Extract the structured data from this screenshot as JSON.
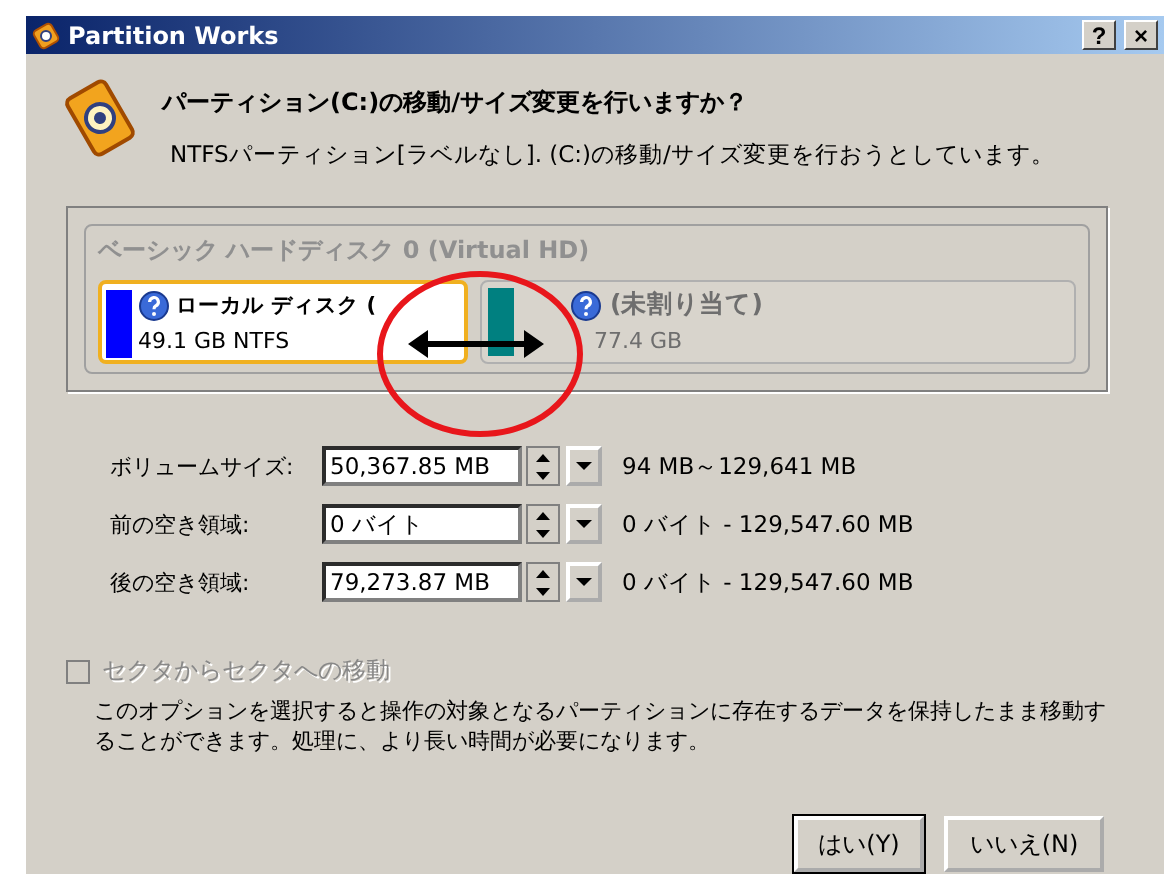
{
  "window": {
    "title": "Partition Works",
    "controls": [
      "?",
      "×"
    ]
  },
  "header": {
    "title": "パーティション(C:)の移動/サイズ変更を行いますか？",
    "subtitle": "NTFSパーティション[ラベルなし]. (C:)の移動/サイズ変更を行おうとしています。"
  },
  "disk": {
    "title": "ベーシック ハードディスク 0 (Virtual HD)",
    "partitions": [
      {
        "label": "ローカル ディスク (",
        "size": "49.1 GB NTFS",
        "color": "#0000ff",
        "selected": true
      },
      {
        "label": "(未割り当て)",
        "size": "77.4 GB",
        "color": "#008080",
        "selected": false
      }
    ]
  },
  "fields": [
    {
      "label": "ボリュームサイズ:",
      "value": "50,367.85 MB",
      "range": "94 MB～129,641 MB"
    },
    {
      "label": "前の空き領域:",
      "value": "0 バイト",
      "range": "0 バイト - 129,547.60 MB"
    },
    {
      "label": "後の空き領域:",
      "value": "79,273.87 MB",
      "range": "0 バイト - 129,547.60 MB"
    }
  ],
  "option": {
    "label": "セクタからセクタへの移動",
    "checked": false,
    "disabled": true,
    "description": "このオプションを選択すると操作の対象となるパーティションに存在するデータを保持したまま移動することができます。処理に、より長い時間が必要になります。"
  },
  "buttons": [
    "はい(Y)",
    "いいえ(N)"
  ]
}
